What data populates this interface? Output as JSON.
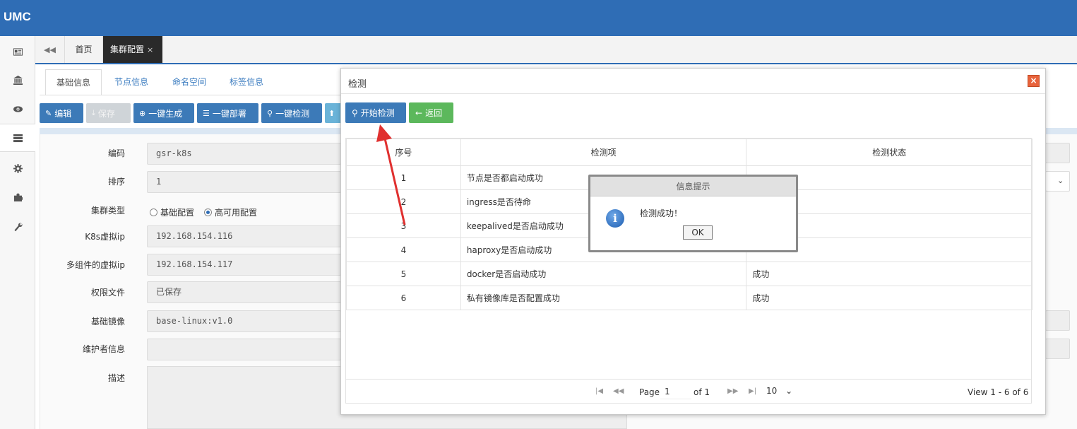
{
  "app": {
    "brand": "UMC"
  },
  "page_tabs": {
    "home": "首页",
    "active": "集群配置",
    "close": "×"
  },
  "inner_tabs": [
    "基础信息",
    "节点信息",
    "命名空间",
    "标签信息"
  ],
  "toolbar": {
    "edit": "编辑",
    "save": "保存",
    "generate": "一键生成",
    "deploy": "一键部署",
    "check": "一键检测"
  },
  "form": {
    "code_label": "编码",
    "code_value": "gsr-k8s",
    "order_label": "排序",
    "order_value": "1",
    "cluster_type_label": "集群类型",
    "cluster_type_options": [
      "基础配置",
      "高可用配置"
    ],
    "cluster_type_selected": "高可用配置",
    "k8s_vip_label": "K8s虚拟ip",
    "k8s_vip_value": "192.168.154.116",
    "multi_vip_label": "多组件的虚拟ip",
    "multi_vip_value": "192.168.154.117",
    "perm_label": "权限文件",
    "perm_value": "已保存",
    "image_label": "基础镜像",
    "image_value": "base-linux:v1.0",
    "maintainer_label": "维护者信息",
    "maintainer_value": "",
    "desc_label": "描述"
  },
  "modal": {
    "title": "检测",
    "start_button": "开始检测",
    "back_button": "返回",
    "columns": [
      "序号",
      "检测项",
      "检测状态"
    ],
    "rows": [
      {
        "no": "1",
        "item": "节点是否都启动成功",
        "status": ""
      },
      {
        "no": "2",
        "item": "ingress是否待命",
        "status": ""
      },
      {
        "no": "3",
        "item": "keepalived是否启动成功",
        "status": ""
      },
      {
        "no": "4",
        "item": "haproxy是否启动成功",
        "status": ""
      },
      {
        "no": "5",
        "item": "docker是否启动成功",
        "status": "成功"
      },
      {
        "no": "6",
        "item": "私有镜像库是否配置成功",
        "status": "成功"
      }
    ],
    "pager": {
      "page_label": "Page",
      "page_value": "1",
      "of_label": "of 1",
      "page_size": "10",
      "summary": "View 1 - 6 of 6"
    }
  },
  "message": {
    "title": "信息提示",
    "text": "检测成功！",
    "ok": "OK"
  },
  "colors": {
    "header": "#2f6db5",
    "primary_button": "#3c7ab8",
    "success_button": "#5cb85c",
    "annotation_arrow": "#e0302f"
  }
}
